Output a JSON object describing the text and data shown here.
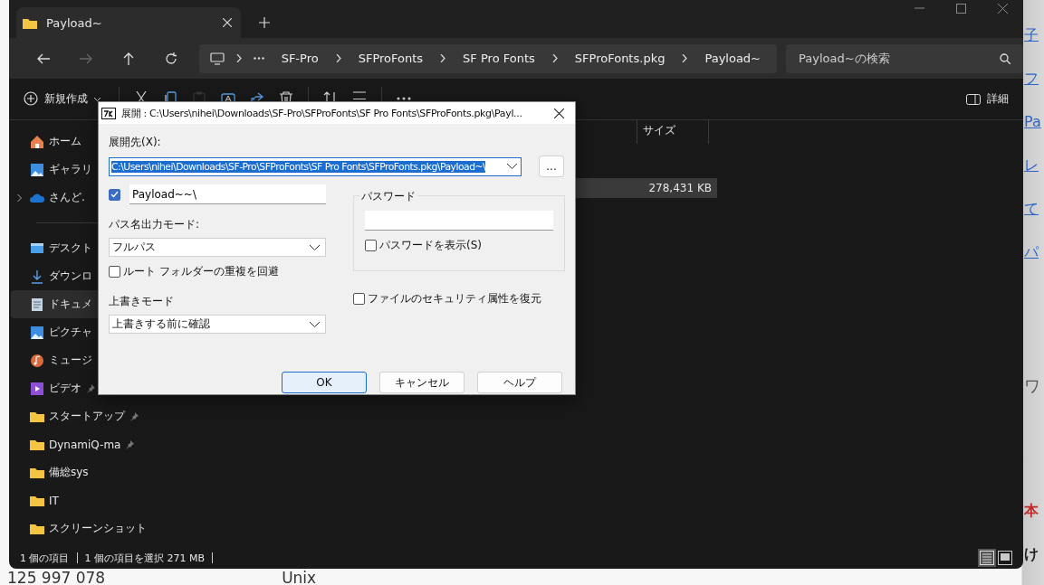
{
  "background_page": {
    "side_texts": [
      {
        "text": "子",
        "kind": "link"
      },
      {
        "text": "フ",
        "kind": "link"
      },
      {
        "text": "Pa",
        "kind": "link"
      },
      {
        "text": "レ",
        "kind": "link"
      },
      {
        "text": "て",
        "kind": "link"
      },
      {
        "text": "パ",
        "kind": "link"
      },
      {
        "text": "ワ",
        "kind": "heading"
      },
      {
        "text": "本",
        "kind": "accent"
      },
      {
        "text": "け",
        "kind": "plain"
      }
    ],
    "bottom_texts": [
      "125 997 078",
      "Unix"
    ]
  },
  "explorer": {
    "tab": {
      "title": "Payload~"
    },
    "breadcrumb": [
      "SF-Pro",
      "SFProFonts",
      "SF Pro Fonts",
      "SFProFonts.pkg",
      "Payload~"
    ],
    "search": {
      "placeholder": "Payload~の検索"
    },
    "toolbar": [
      {
        "kind": "new",
        "label": "新規作成"
      },
      {
        "kind": "cut"
      },
      {
        "kind": "copy"
      },
      {
        "kind": "paste",
        "disabled": true
      },
      {
        "kind": "rename"
      },
      {
        "kind": "share"
      },
      {
        "kind": "delete"
      },
      {
        "kind": "sort"
      },
      {
        "kind": "view"
      },
      {
        "kind": "more"
      }
    ],
    "details_button": "詳細",
    "sidebar": [
      {
        "kind": "home",
        "label": "ホーム",
        "selected": false
      },
      {
        "kind": "gallery",
        "label": "ギャラリ",
        "selected": false
      },
      {
        "kind": "cloud",
        "label": "さんど.",
        "selected": false,
        "expandable": true
      },
      {
        "kind": "divider"
      },
      {
        "kind": "desktop",
        "label": "デスクト",
        "selected": false
      },
      {
        "kind": "download",
        "label": "ダウンロ",
        "selected": false
      },
      {
        "kind": "document",
        "label": "ドキュメ",
        "selected": true
      },
      {
        "kind": "picture",
        "label": "ピクチャ",
        "selected": false
      },
      {
        "kind": "music",
        "label": "ミュージ",
        "selected": false
      },
      {
        "kind": "video",
        "label": "ビデオ",
        "selected": false,
        "pinned": true
      },
      {
        "kind": "folder",
        "label": "スタートアップ",
        "selected": false,
        "pinned": true
      },
      {
        "kind": "folder",
        "label": "DynamiQ-ma",
        "selected": false,
        "pinned": true
      },
      {
        "kind": "folder",
        "label": "備総sys",
        "selected": false
      },
      {
        "kind": "folder",
        "label": "IT",
        "selected": false
      },
      {
        "kind": "folder",
        "label": "スクリーンショット",
        "selected": false
      }
    ],
    "columns": [
      "サイズ"
    ],
    "rows": [
      {
        "size": "278,431 KB",
        "selected": true
      }
    ],
    "status_bar": {
      "item_count": "1 個の項目",
      "selection": "1 個の項目を選択  271 MB"
    },
    "view_modes": [
      {
        "kind": "details",
        "selected": true
      },
      {
        "kind": "tiles",
        "selected": false
      }
    ]
  },
  "dialog": {
    "title": "展開 : C:\\Users\\nihei\\Downloads\\SF-Pro\\SFProFonts\\SF Pro Fonts\\SFProFonts.pkg\\Payl...",
    "destination_label": "展開先(X):",
    "destination": "C:\\Users\\nihei\\Downloads\\SF-Pro\\SFProFonts\\SF Pro Fonts\\SFProFonts.pkg\\Payload~\\",
    "browse_button": "...",
    "subfolder": {
      "checked": true,
      "value": "Payload~~\\"
    },
    "path_mode_label": "パス名出力モード:",
    "path_mode": "フルパス",
    "avoid_duplicate": {
      "label": "ルート フォルダーの重複を回避",
      "checked": false
    },
    "overwrite_label": "上書きモード",
    "overwrite_mode": "上書きする前に確認",
    "password_group": {
      "title": "パスワード",
      "show": {
        "label": "パスワードを表示(S)",
        "checked": false
      }
    },
    "restore_security": {
      "label": "ファイルのセキュリティ属性を復元",
      "checked": false
    },
    "buttons": [
      {
        "label": "OK",
        "default": true
      },
      {
        "label": "キャンセル",
        "default": false
      },
      {
        "label": "ヘルプ",
        "default": false
      }
    ]
  }
}
